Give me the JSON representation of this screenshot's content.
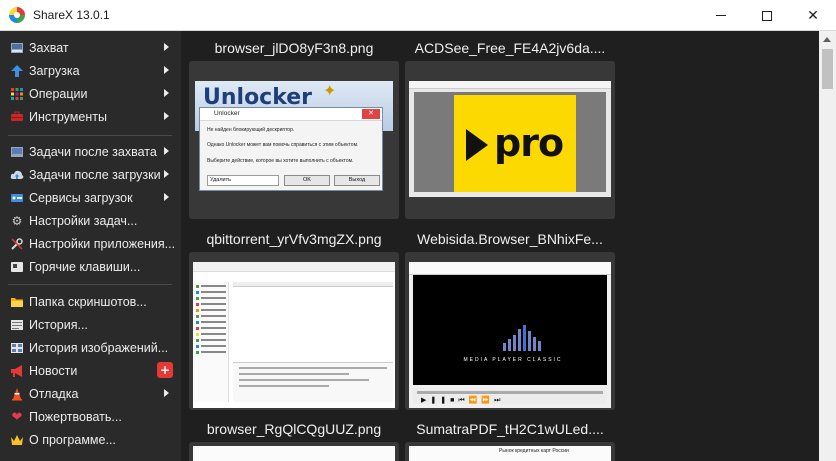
{
  "window": {
    "title": "ShareX 13.0.1"
  },
  "sidebar": {
    "items": [
      {
        "label": "Захват",
        "icon": "capture-icon"
      },
      {
        "label": "Загрузка",
        "icon": "upload-arrow-icon"
      },
      {
        "label": "Операции",
        "icon": "workflows-grid-icon"
      },
      {
        "label": "Инструменты",
        "icon": "tools-icon"
      },
      {
        "label": "Задачи после захвата",
        "icon": "after-capture-icon"
      },
      {
        "label": "Задачи после загрузки",
        "icon": "after-upload-cloud-icon"
      },
      {
        "label": "Сервисы загрузок",
        "icon": "destinations-icon"
      },
      {
        "label": "Настройки задач...",
        "icon": "gear-icon"
      },
      {
        "label": "Настройки приложения...",
        "icon": "wrench-icon"
      },
      {
        "label": "Горячие клавиши...",
        "icon": "keyboard-icon"
      },
      {
        "label": "Папка скриншотов...",
        "icon": "folder-icon"
      },
      {
        "label": "История...",
        "icon": "history-icon"
      },
      {
        "label": "История изображений...",
        "icon": "image-history-icon"
      },
      {
        "label": "Новости",
        "icon": "megaphone-icon",
        "badge": "+"
      },
      {
        "label": "Отладка",
        "icon": "cone-icon"
      },
      {
        "label": "Пожертвовать...",
        "icon": "heart-icon"
      },
      {
        "label": "О программе...",
        "icon": "crown-icon"
      }
    ]
  },
  "thumbnails": [
    {
      "title": "browser_jlDO8yF3n8.png"
    },
    {
      "title": "ACDSee_Free_FE4A2jv6da...."
    },
    {
      "title": "qbittorrent_yrVfv3mgZX.png"
    },
    {
      "title": "Webisida.Browser_BNhixFe..."
    },
    {
      "title": "browser_RgQlCQgUUZ.png"
    },
    {
      "title": "SumatraPDF_tH2C1wULed...."
    }
  ],
  "unlocker": {
    "logo": "Unlocker",
    "dialog_title": "Unlocker",
    "line1": "Не найден блокирующий дескриптор.",
    "line2": "Однако Unlocker может вам помочь справиться с этим объектом.",
    "line3": "Выберите действие, которое вы хотите выполнить с объектом.",
    "select_value": "Удалить",
    "ok_label": "OK",
    "exit_label": "Выход"
  },
  "acdsee": {
    "logo_text": "pro"
  },
  "mpc": {
    "caption": "MEDIA PLAYER CLASSIC"
  },
  "sumatra_preview": {
    "text": "Рынок кредитных карт России"
  },
  "colors": {
    "sidebar_bg": "#2a2a2a",
    "content_bg": "#1f1f1f",
    "thumb_bg": "#383838",
    "badge_red": "#e53935",
    "acdsee_yellow": "#fcd900"
  }
}
